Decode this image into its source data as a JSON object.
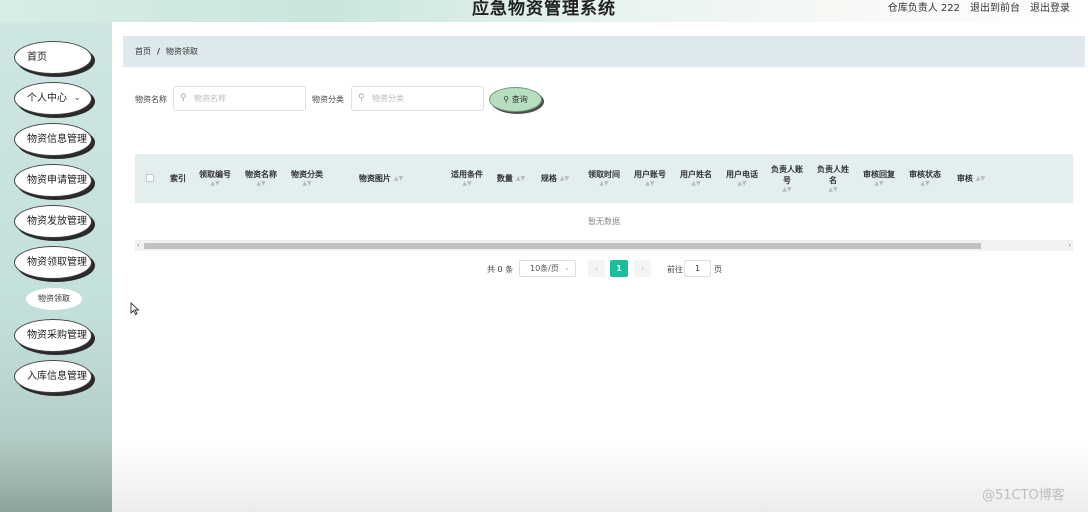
{
  "header": {
    "title": "应急物资管理系统",
    "user": "仓库负责人 222",
    "front": "退出到前台",
    "logout": "退出登录"
  },
  "sidebar": {
    "items": [
      {
        "label": "首页"
      },
      {
        "label": "个人中心"
      },
      {
        "label": "物资信息管理"
      },
      {
        "label": "物资申请管理"
      },
      {
        "label": "物资发放管理"
      },
      {
        "label": "物资领取管理"
      },
      {
        "label": "物资采购管理"
      },
      {
        "label": "入库信息管理"
      }
    ],
    "sub": "物资领取",
    "chevron": "⌄"
  },
  "breadcrumb": {
    "home": "首页",
    "sep": "/",
    "current": "物资领取"
  },
  "search": {
    "name_label": "物资名称",
    "name_placeholder": "物资名称",
    "cat_label": "物资分类",
    "cat_placeholder": "物资分类",
    "button": "查询",
    "icon": "⚲"
  },
  "table": {
    "columns": [
      "索引",
      "领取编号",
      "物资名称",
      "物资分类",
      "物资图片",
      "适用条件",
      "数量",
      "规格",
      "领取时间",
      "用户账号",
      "用户姓名",
      "用户电话",
      "负责人账号",
      "负责人姓名",
      "审核回复",
      "审核状态",
      "审核"
    ],
    "empty": "暂无数据",
    "sort": "▲▼"
  },
  "pagination": {
    "total": "共 0 条",
    "size": "10条/页",
    "prev": "‹",
    "next": "›",
    "page": "1",
    "goto": "前往",
    "goto_value": "1",
    "page_unit": "页",
    "arrow": "⌄"
  },
  "watermark": "@51CTO博客"
}
